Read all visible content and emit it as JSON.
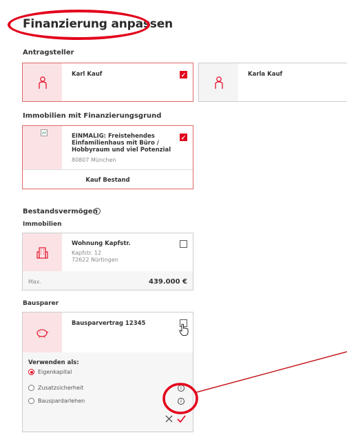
{
  "page": {
    "title": "Finanzierung anpassen"
  },
  "applicants": {
    "section": "Antragsteller",
    "items": [
      {
        "name": "Karl Kauf",
        "selected": true,
        "icon": "person-icon"
      },
      {
        "name": "Karla Kauf",
        "selected": false,
        "icon": "person-icon"
      }
    ]
  },
  "properties": {
    "section": "Immobilien mit Finanzierungsgrund",
    "card": {
      "title": "EINMALIG: Freistehendes Einfamilienhaus mit Büro / Hobbyraum und viel Potenzial",
      "location": "80807 München",
      "footer": "Kauf Bestand",
      "selected": true,
      "icon": "broken-image-icon"
    }
  },
  "assets": {
    "section": "Bestandsvermögen",
    "info_icon": "info-icon",
    "immobilien": {
      "label": "Immobilien",
      "card": {
        "title": "Wohnung Kapfstr.",
        "street": "Kapfstr. 12",
        "city": "72622 Nürtingen",
        "max_label": "Max.",
        "max_value": "439.000 €",
        "icon": "building-icon",
        "selected": false
      }
    },
    "bausparer": {
      "label": "Bausparer",
      "card": {
        "title": "Bausparvertrag 12345",
        "icon": "piggy-bank-icon",
        "selected": false,
        "use_as_label": "Verwenden als:",
        "options": [
          {
            "label": "Eigenkapital",
            "selected": true
          },
          {
            "label": "Zusatzsicherheit",
            "selected": false
          },
          {
            "label": "Bauspardarlehen",
            "selected": false
          }
        ]
      }
    }
  },
  "colors": {
    "accent": "#e3001b",
    "selected_bg": "#fbe3e5",
    "annotation": "#e3001b"
  }
}
